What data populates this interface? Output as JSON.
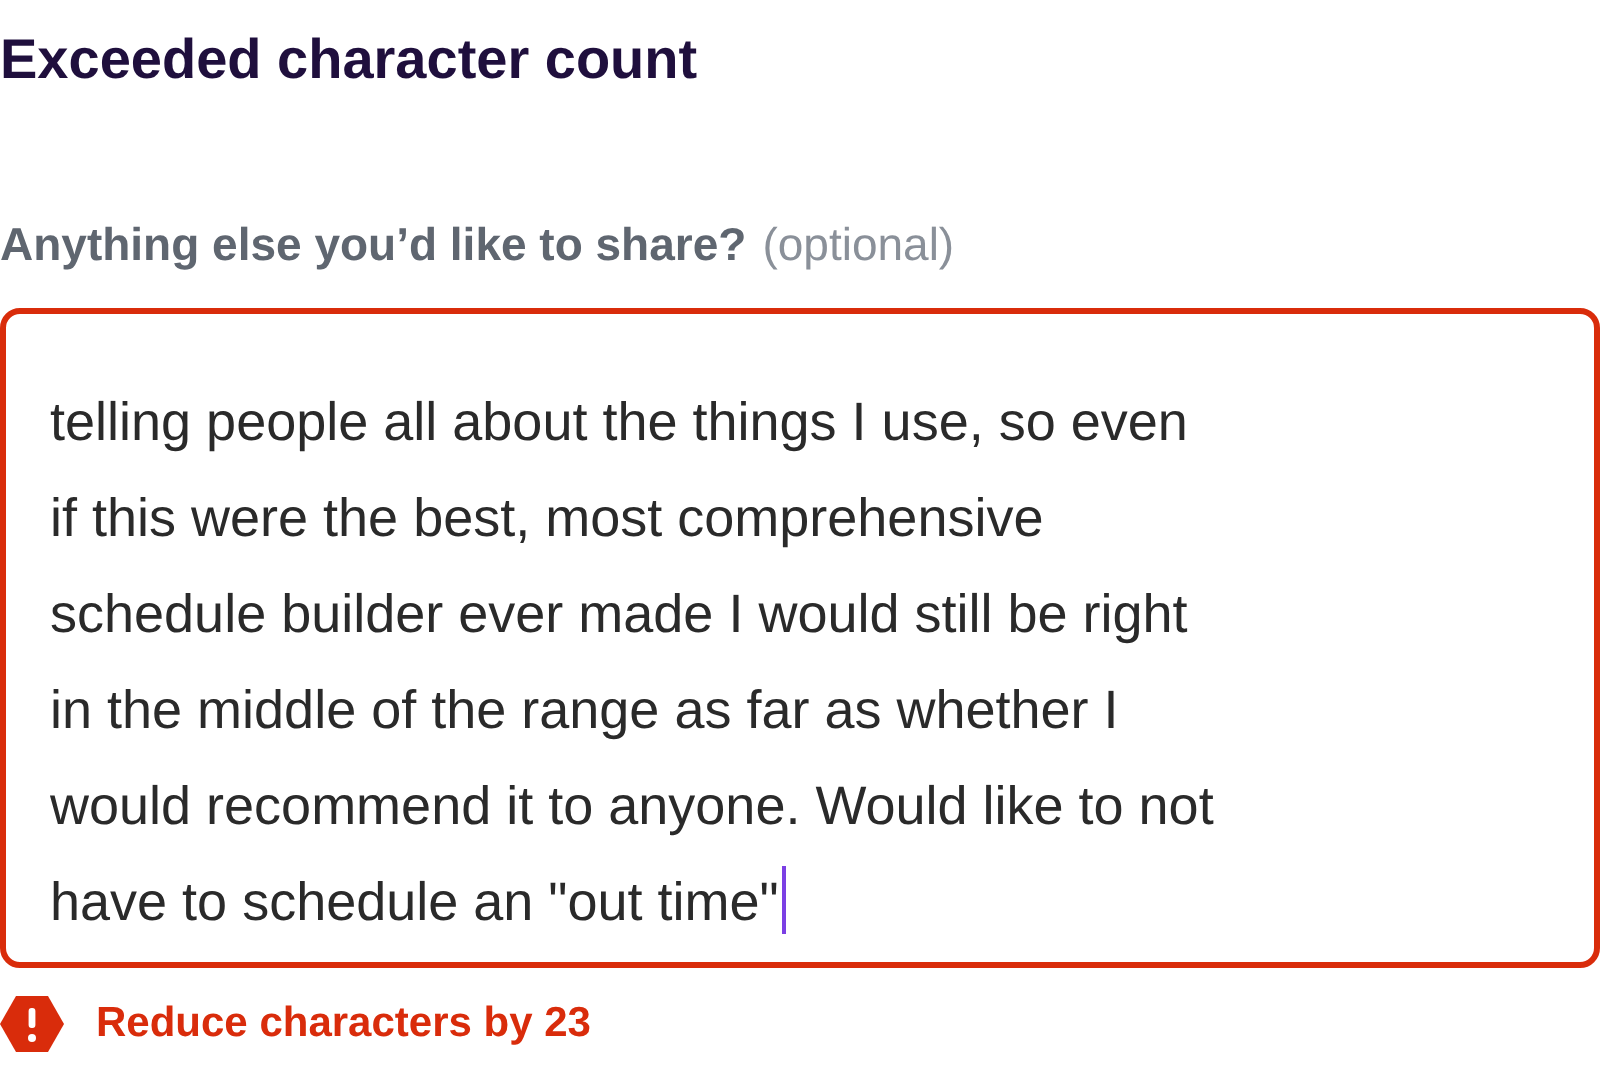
{
  "title": "Exceeded character count",
  "field": {
    "label": "Anything else you’d like to share?",
    "hint": "(optional)",
    "invalid": true,
    "focused": true,
    "value_lines": [
      "telling people all about the things I use, so even",
      "if this were the best, most comprehensive",
      "schedule builder ever made I would still be right",
      "in the middle of the range as far as whether I",
      "would recommend it to anyone. Would like to not",
      "have to schedule an \"out time\""
    ]
  },
  "error": {
    "message": "Reduce characters by 23"
  }
}
